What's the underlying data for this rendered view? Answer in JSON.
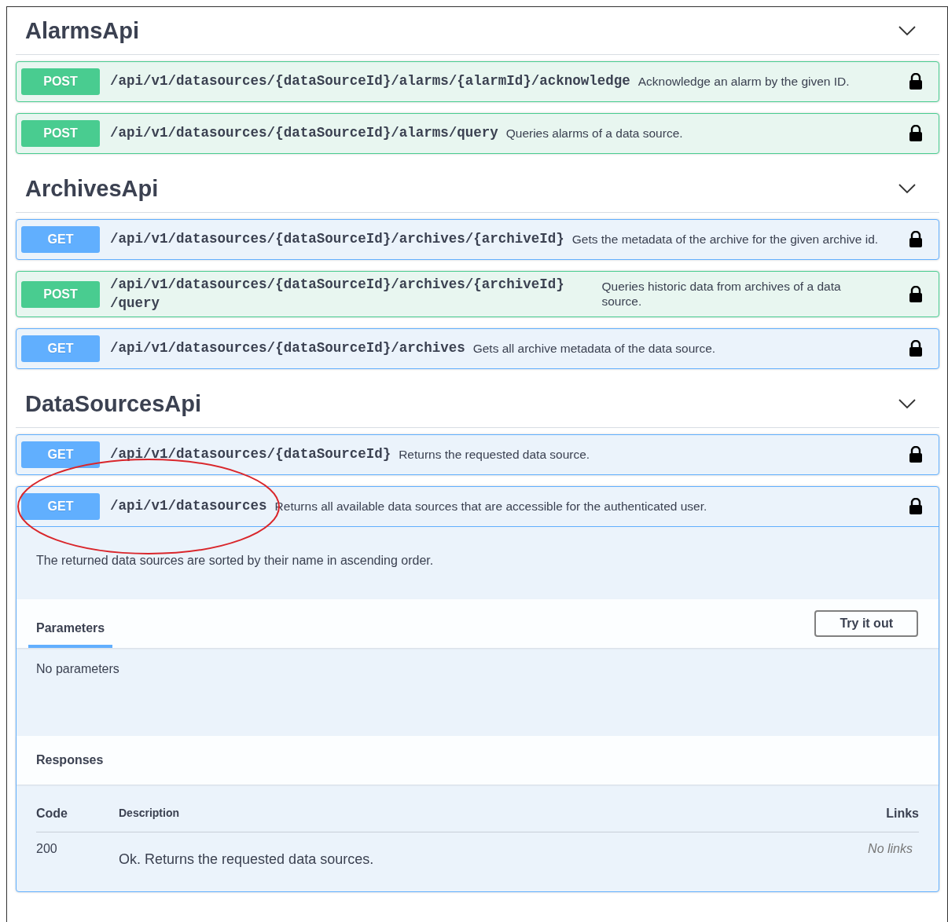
{
  "sections": [
    {
      "title": "AlarmsApi",
      "expanded": true,
      "operations": [
        {
          "method": "POST",
          "path": "/api/v1/datasources/{dataSourceId}/alarms/{alarmId}/acknowledge",
          "summary": "Acknowledge an alarm by the given ID.",
          "locked": true
        },
        {
          "method": "POST",
          "path": "/api/v1/datasources/{dataSourceId}/alarms/query",
          "summary": "Queries alarms of a data source.",
          "locked": true
        }
      ]
    },
    {
      "title": "ArchivesApi",
      "expanded": true,
      "operations": [
        {
          "method": "GET",
          "path": "/api/v1/datasources/{dataSourceId}/archives/{archiveId}",
          "summary": "Gets the metadata of the archive for the given archive id.",
          "locked": true
        },
        {
          "method": "POST",
          "path": "/api/v1/datasources/{dataSourceId}/archives/{archiveId}/query",
          "summary": "Queries historic data from archives of a data source.",
          "locked": true
        },
        {
          "method": "GET",
          "path": "/api/v1/datasources/{dataSourceId}/archives",
          "summary": "Gets all archive metadata of the data source.",
          "locked": true
        }
      ]
    },
    {
      "title": "DataSourcesApi",
      "expanded": true,
      "operations": [
        {
          "method": "GET",
          "path": "/api/v1/datasources/{dataSourceId}",
          "summary": "Returns the requested data source.",
          "locked": true
        },
        {
          "method": "GET",
          "path": "/api/v1/datasources",
          "summary": "Returns all available data sources that are accessible for the authenticated user.",
          "locked": true,
          "highlight": true,
          "expanded": true,
          "details": {
            "description": "The returned data sources are sorted by their name in ascending order.",
            "parameters_tab": {
              "label": "Parameters",
              "selected": true
            },
            "try_button": "Try it out",
            "no_parameters": "No parameters",
            "responses_title": "Responses",
            "columns": [
              "Code",
              "Description",
              "Links"
            ],
            "rows": [
              {
                "code": "200",
                "description": "Ok. Returns the requested data sources.",
                "links": "No links"
              }
            ]
          }
        }
      ]
    }
  ]
}
